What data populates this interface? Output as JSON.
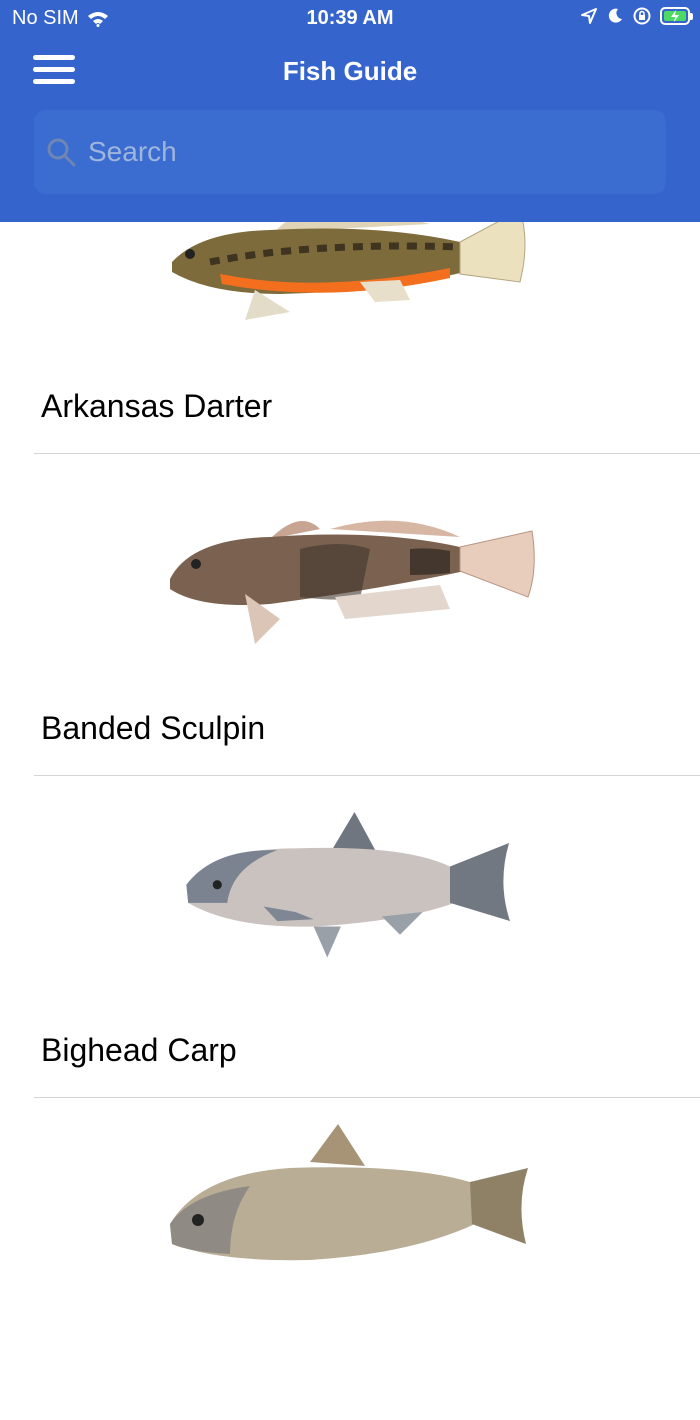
{
  "status_bar": {
    "carrier": "No SIM",
    "time": "10:39 AM"
  },
  "nav": {
    "title": "Fish Guide"
  },
  "search": {
    "placeholder": "Search",
    "value": ""
  },
  "fish_list": [
    {
      "name": "Arkansas Darter"
    },
    {
      "name": "Banded Sculpin"
    },
    {
      "name": "Bighead Carp"
    },
    {
      "name": ""
    }
  ],
  "colors": {
    "header": "#3564cd",
    "search_field": "#3b6cd0",
    "divider": "#d4d4d4"
  }
}
